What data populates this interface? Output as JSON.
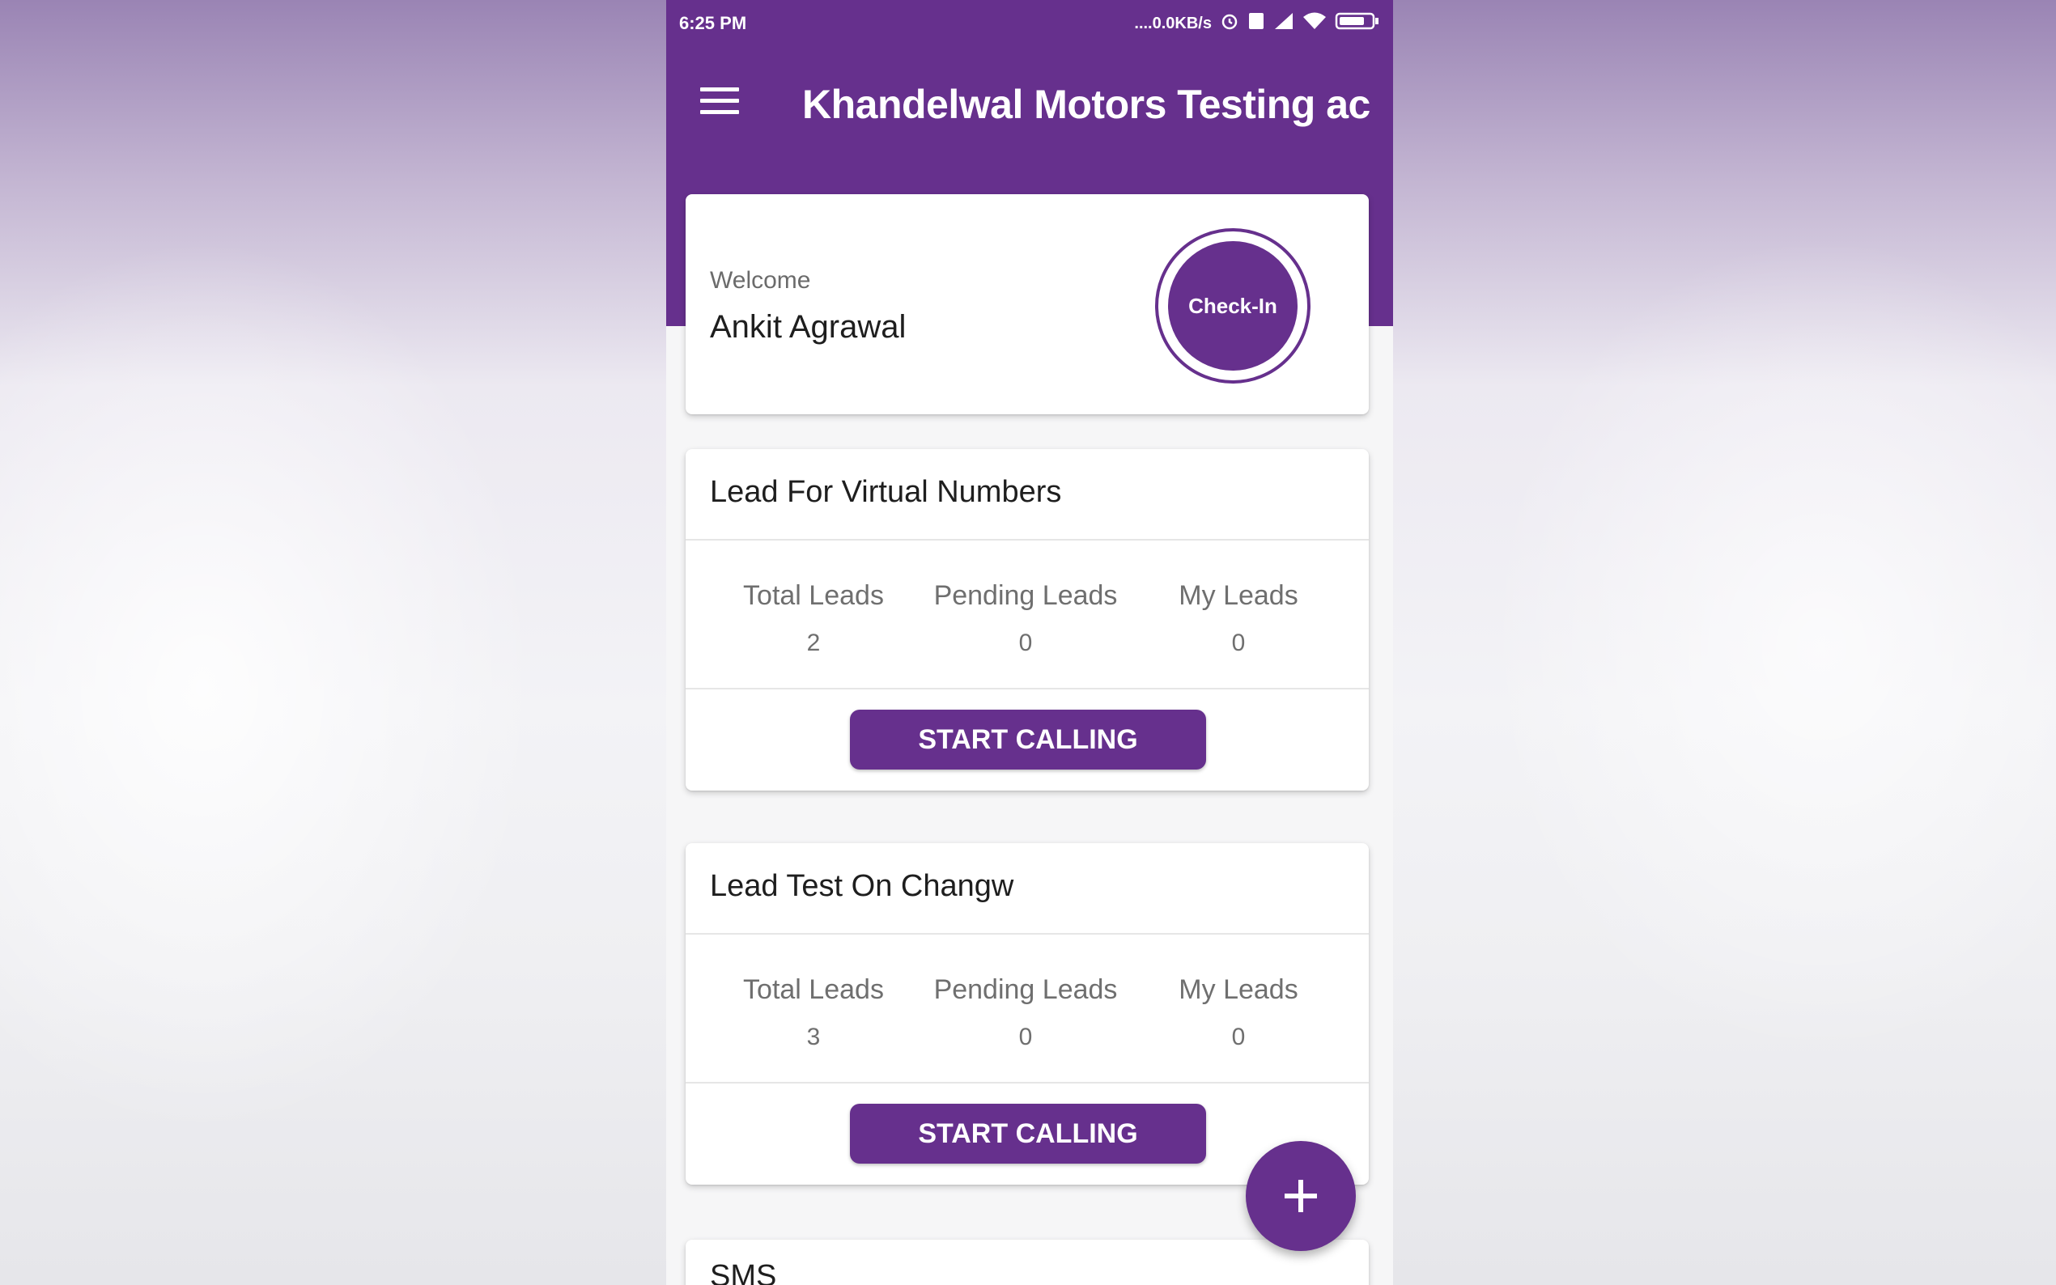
{
  "status_bar": {
    "time": "6:25 PM",
    "net_speed": "....0.0KB/s",
    "icons": [
      "alarm-icon",
      "sim-icon",
      "signal-icon",
      "wifi-icon",
      "battery-icon"
    ]
  },
  "app_bar": {
    "title": "Khandelwal Motors Testing ac",
    "menu_icon": "hamburger-menu-icon"
  },
  "welcome_card": {
    "label": "Welcome",
    "user_name": "Ankit Agrawal",
    "checkin_label": "Check-In"
  },
  "lead_cards": [
    {
      "title": "Lead For Virtual Numbers",
      "stats": [
        {
          "label": "Total Leads",
          "value": "2"
        },
        {
          "label": "Pending Leads",
          "value": "0"
        },
        {
          "label": "My Leads",
          "value": "0"
        }
      ],
      "button_label": "START CALLING"
    },
    {
      "title": "Lead Test On Changw",
      "stats": [
        {
          "label": "Total Leads",
          "value": "3"
        },
        {
          "label": "Pending Leads",
          "value": "0"
        },
        {
          "label": "My Leads",
          "value": "0"
        }
      ],
      "button_label": "START CALLING"
    }
  ],
  "sms_card": {
    "title": "SMS"
  },
  "fab": {
    "icon": "plus-icon"
  },
  "colors": {
    "primary": "#66308d",
    "card_background": "#ffffff",
    "page_background": "#f6f6f7",
    "text_primary": "#1e1e1e",
    "text_secondary": "#6f6f6f"
  }
}
